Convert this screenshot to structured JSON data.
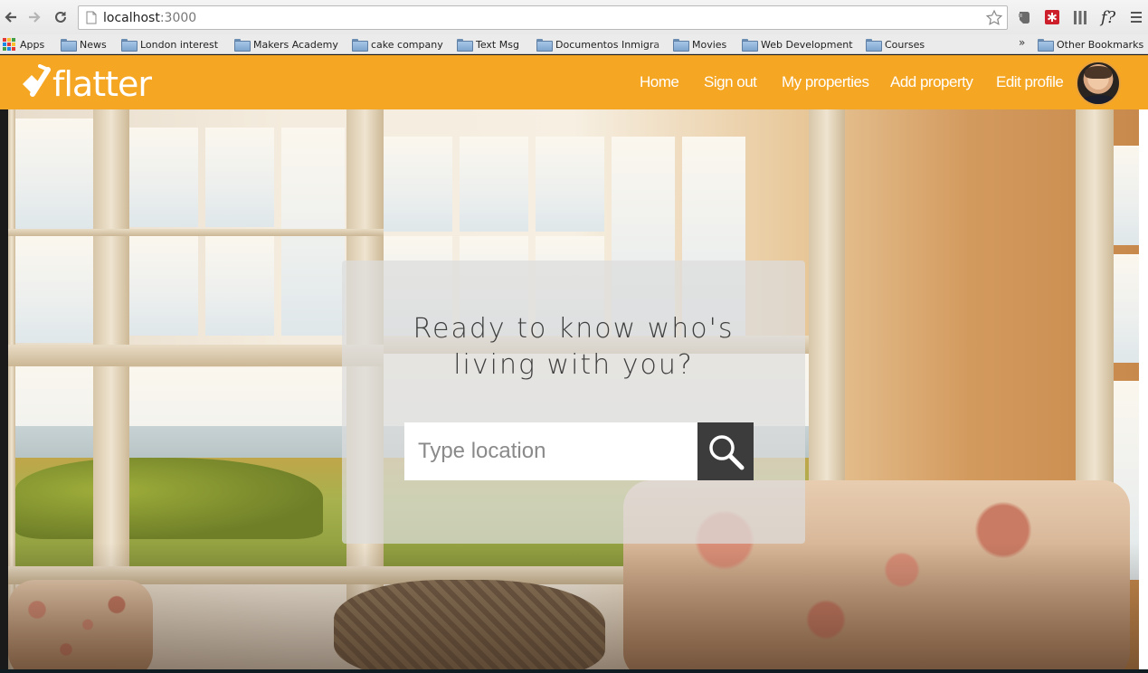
{
  "browser": {
    "url_host": "localhost",
    "url_port": ":3000",
    "icons": [
      "back-icon",
      "forward-icon",
      "reload-icon",
      "page-icon",
      "bookmark-star-icon",
      "evernote-icon",
      "lastpass-icon",
      "readability-icon",
      "font-helper-icon",
      "menu-icon"
    ],
    "font_ext_label": "f?"
  },
  "bookmarks": {
    "items": [
      {
        "label": "Apps"
      },
      {
        "label": "News"
      },
      {
        "label": "London interest"
      },
      {
        "label": "Makers Academy"
      },
      {
        "label": "cake company"
      },
      {
        "label": "Text Msg"
      },
      {
        "label": "Documentos Inmigra"
      },
      {
        "label": "Movies"
      },
      {
        "label": "Web Development"
      },
      {
        "label": "Courses"
      }
    ],
    "overflow": "»",
    "other": "Other Bookmarks"
  },
  "app": {
    "logo_text": "flatter",
    "brand_color": "#f5a623",
    "nav": [
      {
        "label": "Home"
      },
      {
        "label": "Sign out"
      },
      {
        "label": "My properties"
      },
      {
        "label": "Add property"
      },
      {
        "label": "Edit profile"
      }
    ]
  },
  "hero": {
    "headline": "Ready to know who's\nliving with you?",
    "search_placeholder": "Type location",
    "search_button_icon": "magnifier-icon"
  }
}
